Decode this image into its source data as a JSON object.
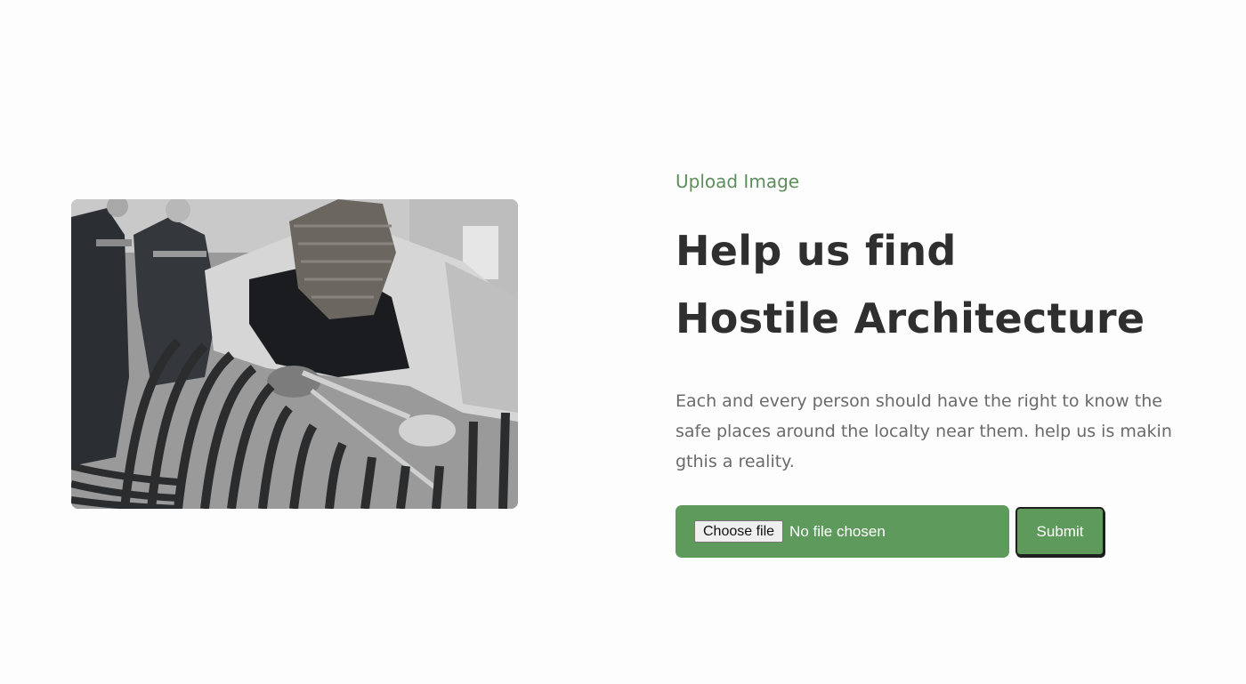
{
  "hero": {
    "eyebrow": "Upload Image",
    "title_line1": "Help us find",
    "title_line2": "Hostile Architecture",
    "description": "Each and every person should have the right to know the safe places around the localty near them. help us is makin gthis a reality."
  },
  "upload_form": {
    "choose_file_label": "Choose file",
    "file_status": "No file chosen",
    "submit_label": "Submit"
  },
  "colors": {
    "accent_green": "#5e9a5c",
    "eyebrow_green": "#5e8e5c",
    "heading": "#2f2f2f",
    "body_text": "#6a6a6a"
  }
}
